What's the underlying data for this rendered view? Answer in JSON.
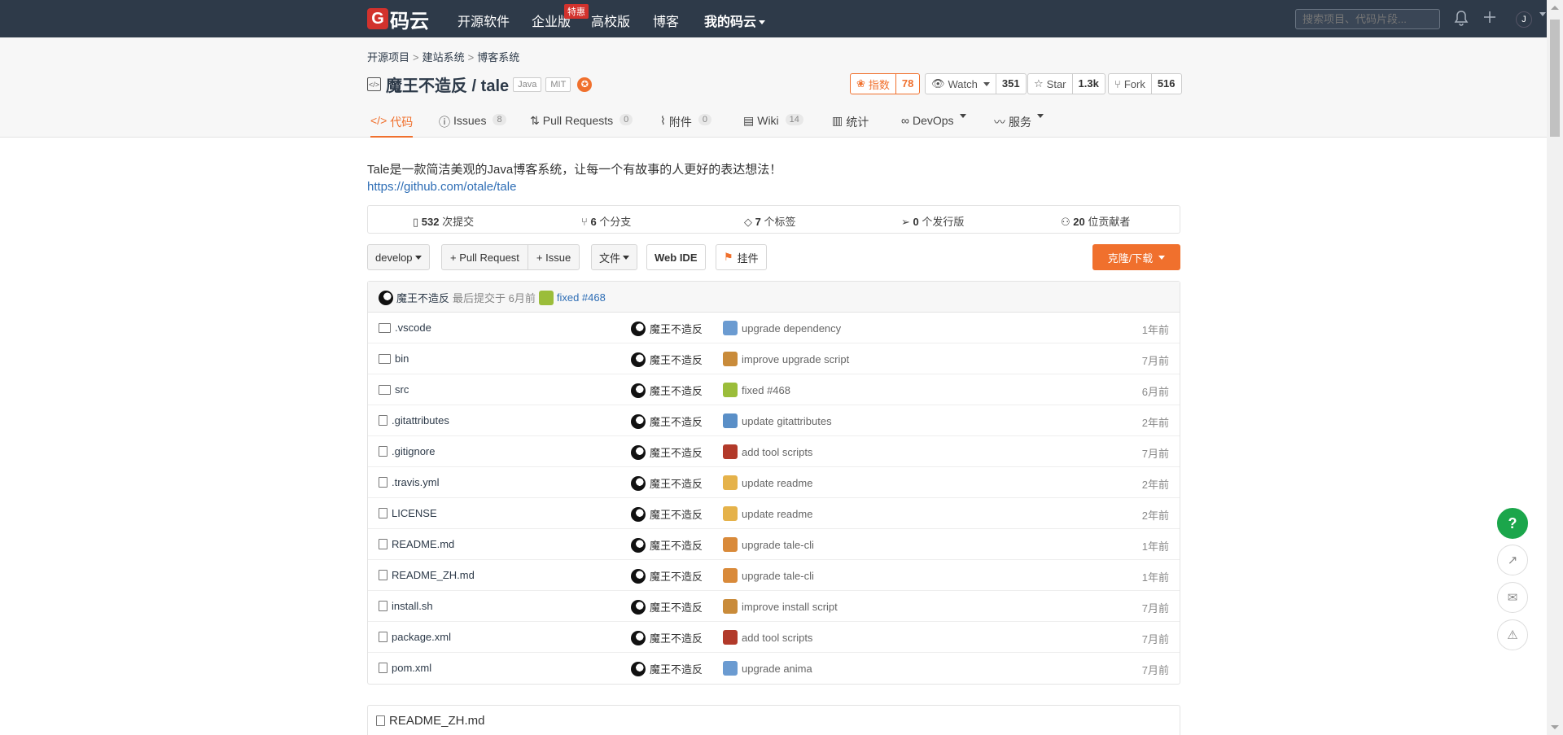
{
  "nav": {
    "logo_letter": "G",
    "logo_text": "码云",
    "items": [
      "开源软件",
      "企业版",
      "高校版",
      "博客",
      "我的码云"
    ],
    "badge": "特惠",
    "search_placeholder": "搜索项目、代码片段...",
    "user_initial": "J"
  },
  "breadcrumb": [
    "开源项目",
    "建站系统",
    "博客系统"
  ],
  "repo": {
    "name": "魔王不造反 / tale",
    "tags": [
      "Java",
      "MIT"
    ],
    "index_label": "指数",
    "index_value": "78",
    "watch_label": "Watch",
    "watch_count": "351",
    "star_label": "Star",
    "star_count": "1.3k",
    "fork_label": "Fork",
    "fork_count": "516",
    "description": "Tale是一款简洁美观的Java博客系统，让每一个有故事的人更好的表达想法！",
    "link": "https://github.com/otale/tale"
  },
  "tabs": [
    {
      "label": "代码",
      "count": ""
    },
    {
      "label": "Issues",
      "count": "8"
    },
    {
      "label": "Pull Requests",
      "count": "0"
    },
    {
      "label": "附件",
      "count": "0"
    },
    {
      "label": "Wiki",
      "count": "14"
    },
    {
      "label": "统计",
      "count": ""
    },
    {
      "label": "DevOps",
      "count": ""
    },
    {
      "label": "服务",
      "count": ""
    }
  ],
  "stats": [
    {
      "value": "532",
      "label": "次提交"
    },
    {
      "value": "6",
      "label": "个分支"
    },
    {
      "value": "7",
      "label": "个标签"
    },
    {
      "value": "0",
      "label": "个发行版"
    },
    {
      "value": "20",
      "label": "位贡献者"
    }
  ],
  "toolbar": {
    "branch": "develop",
    "pull_request": "+ Pull Request",
    "issue": "+ Issue",
    "file": "文件",
    "web_ide": "Web IDE",
    "widget": "挂件",
    "clone": "克隆/下载"
  },
  "last_commit": {
    "author": "魔王不造反",
    "prefix": "最后提交于 6月前",
    "message": "fixed #468"
  },
  "files": [
    {
      "type": "folder",
      "name": ".vscode",
      "author": "魔王不造反",
      "message": "upgrade dependency",
      "time": "1年前",
      "emoji_color": "#6b9bd1"
    },
    {
      "type": "folder",
      "name": "bin",
      "author": "魔王不造反",
      "message": "improve upgrade script",
      "time": "7月前",
      "emoji_color": "#c98b3a"
    },
    {
      "type": "folder",
      "name": "src",
      "author": "魔王不造反",
      "message": "fixed #468",
      "time": "6月前",
      "emoji_color": "#9bbd3a"
    },
    {
      "type": "file",
      "name": ".gitattributes",
      "author": "魔王不造反",
      "message": "update gitattributes",
      "time": "2年前",
      "emoji_color": "#5a8fc7"
    },
    {
      "type": "file",
      "name": ".gitignore",
      "author": "魔王不造反",
      "message": "add tool scripts",
      "time": "7月前",
      "emoji_color": "#b23a2a"
    },
    {
      "type": "file",
      "name": ".travis.yml",
      "author": "魔王不造反",
      "message": "update readme",
      "time": "2年前",
      "emoji_color": "#e5b24a"
    },
    {
      "type": "file",
      "name": "LICENSE",
      "author": "魔王不造反",
      "message": "update readme",
      "time": "2年前",
      "emoji_color": "#e5b24a"
    },
    {
      "type": "file",
      "name": "README.md",
      "author": "魔王不造反",
      "message": "upgrade tale-cli",
      "time": "1年前",
      "emoji_color": "#d98a3a"
    },
    {
      "type": "file",
      "name": "README_ZH.md",
      "author": "魔王不造反",
      "message": "upgrade tale-cli",
      "time": "1年前",
      "emoji_color": "#d98a3a"
    },
    {
      "type": "file",
      "name": "install.sh",
      "author": "魔王不造反",
      "message": "improve install script",
      "time": "7月前",
      "emoji_color": "#c98b3a"
    },
    {
      "type": "file",
      "name": "package.xml",
      "author": "魔王不造反",
      "message": "add tool scripts",
      "time": "7月前",
      "emoji_color": "#b23a2a"
    },
    {
      "type": "file",
      "name": "pom.xml",
      "author": "魔王不造反",
      "message": "upgrade anima",
      "time": "7月前",
      "emoji_color": "#6b9bd1"
    }
  ],
  "readme": {
    "title": "README_ZH.md"
  },
  "float": {
    "help": "?"
  },
  "colors": {
    "accent": "#f0702d",
    "navbar": "#2e3a49",
    "help": "#1ba64b"
  }
}
